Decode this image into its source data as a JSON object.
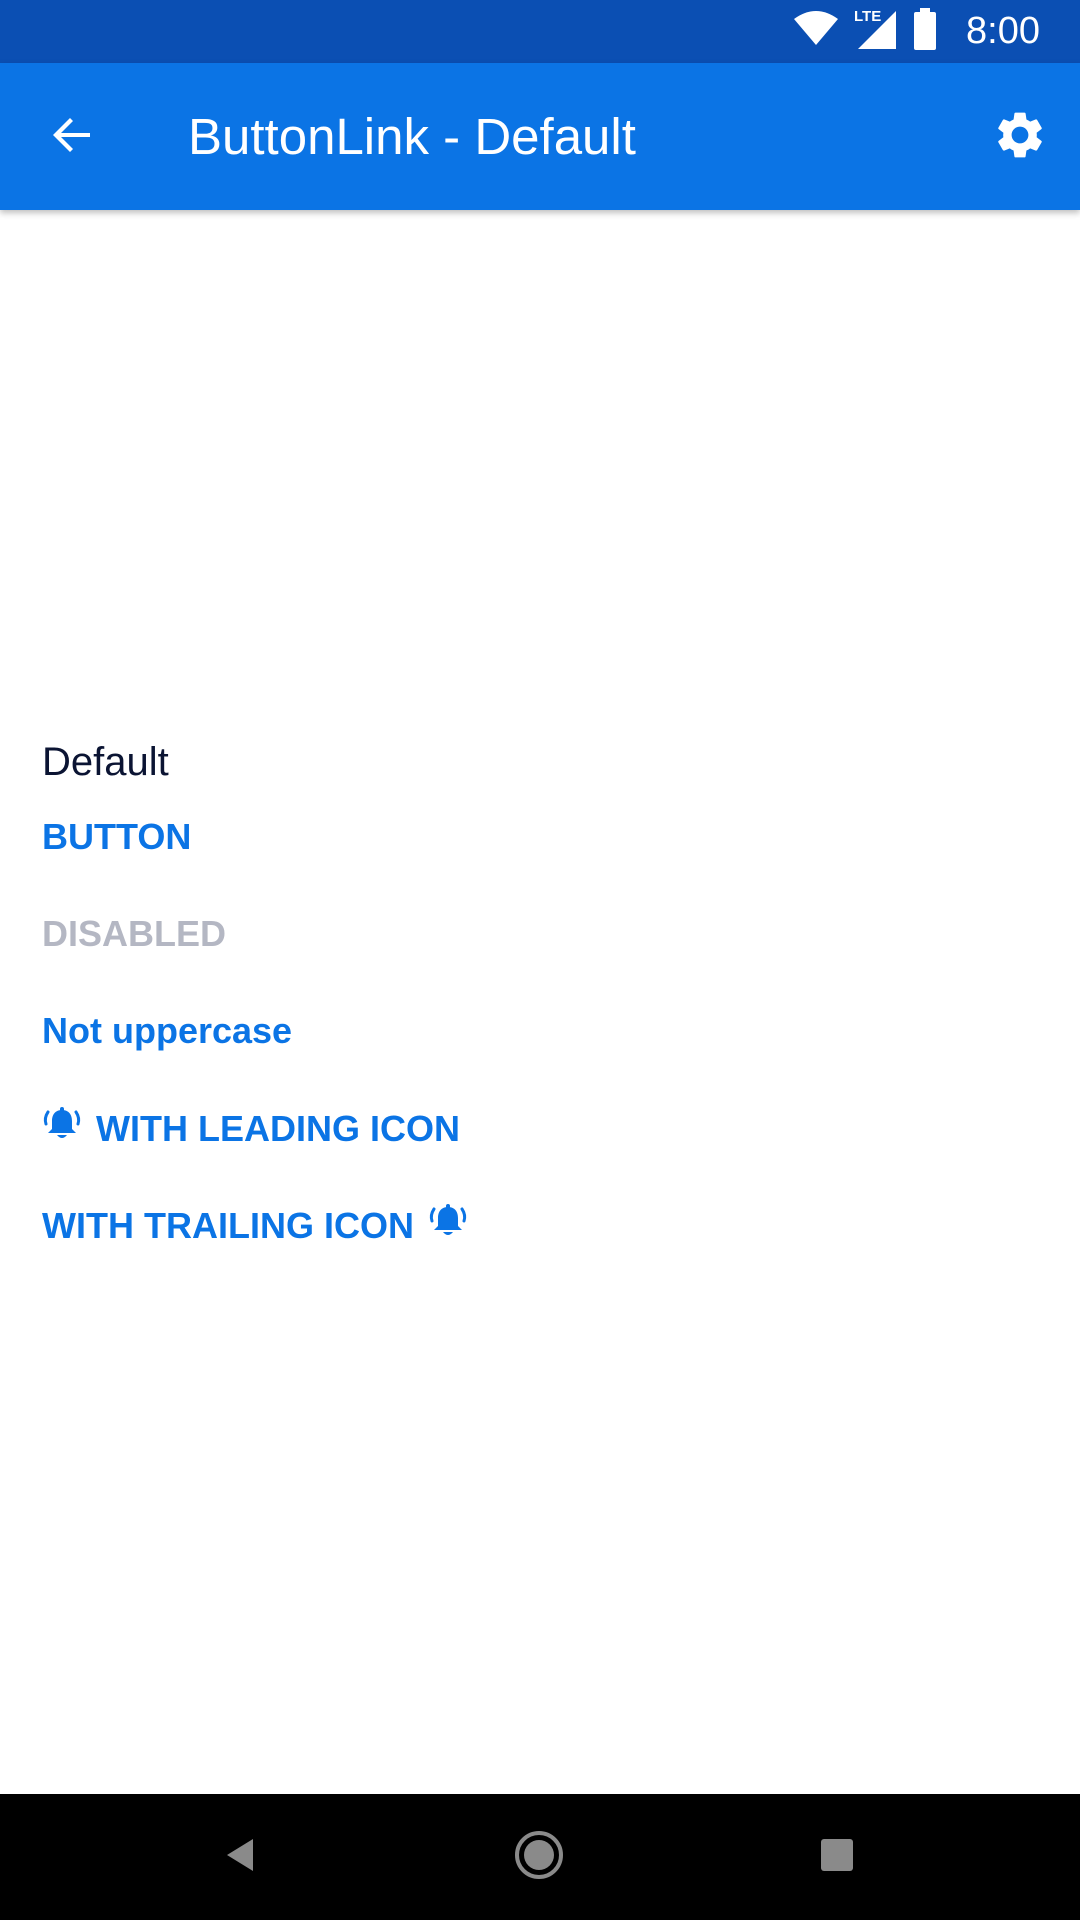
{
  "status_bar": {
    "time": "8:00",
    "network": "LTE",
    "icons": [
      "wifi-icon",
      "lte-signal-icon",
      "battery-icon"
    ]
  },
  "app_bar": {
    "title": "ButtonLink - Default",
    "back_icon": "arrow-back-icon",
    "settings_icon": "gear-icon"
  },
  "content": {
    "section_title": "Default",
    "buttons": [
      {
        "label": "BUTTON",
        "state": "enabled"
      },
      {
        "label": "DISABLED",
        "state": "disabled"
      },
      {
        "label": "Not uppercase",
        "state": "enabled"
      },
      {
        "label": "WITH LEADING ICON",
        "state": "enabled",
        "icon": "bell-ringing-icon",
        "icon_position": "leading"
      },
      {
        "label": "WITH TRAILING ICON",
        "state": "enabled",
        "icon": "bell-ringing-icon",
        "icon_position": "trailing"
      }
    ]
  },
  "nav_bar": {
    "icons": [
      "nav-back-icon",
      "nav-home-icon",
      "nav-recents-icon"
    ]
  },
  "colors": {
    "status_bar": "#0b4fb3",
    "app_bar": "#0b74e5",
    "link": "#0b74e5",
    "disabled": "#b4b7c3",
    "section_title": "#0b1433"
  }
}
